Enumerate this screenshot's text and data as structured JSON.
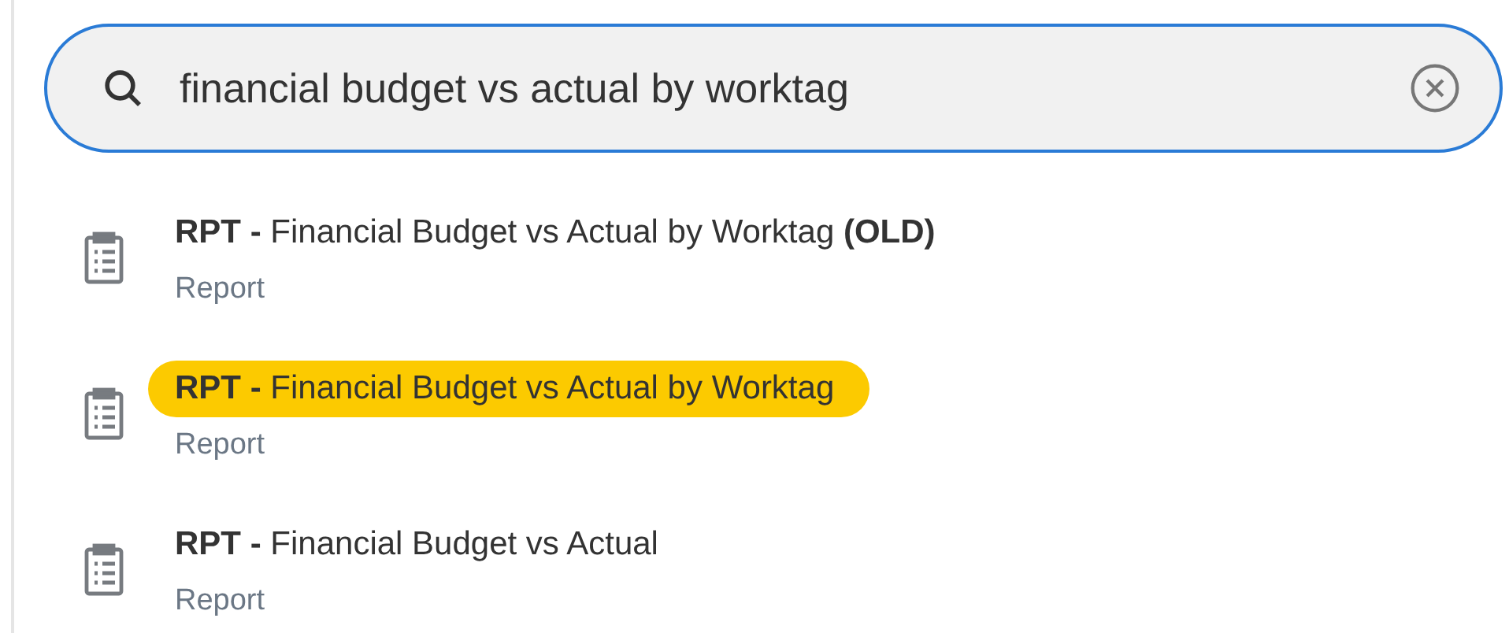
{
  "search": {
    "value": "financial budget vs actual by worktag"
  },
  "results": [
    {
      "title": "**RPT -** Financial Budget vs Actual by Worktag **(OLD)**",
      "subtitle": "Report",
      "highlighted": false
    },
    {
      "title": "**RPT -** Financial Budget vs Actual by Worktag",
      "subtitle": "Report",
      "highlighted": true
    },
    {
      "title": "**RPT -** Financial Budget vs Actual",
      "subtitle": "Report",
      "highlighted": false
    }
  ]
}
